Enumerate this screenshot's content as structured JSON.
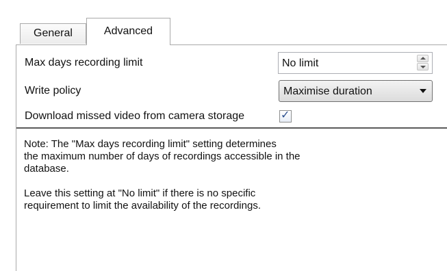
{
  "tabs": [
    {
      "label": "General",
      "active": false
    },
    {
      "label": "Advanced",
      "active": true
    }
  ],
  "settings": {
    "max_days": {
      "label": "Max days recording limit",
      "value": "No limit"
    },
    "write_policy": {
      "label": "Write policy",
      "value": "Maximise duration"
    },
    "download_missed": {
      "label": "Download missed video from camera storage",
      "checked": true
    }
  },
  "note": {
    "line1": "Note: The \"Max days recording limit\" setting determines",
    "line2": "the maximum number of days of recordings accessible in the",
    "line3": "database.",
    "line4": "Leave this setting at \"No limit\" if there is no specific",
    "line5": "requirement to limit the availability of the recordings."
  },
  "icons": {
    "spin_up": "chevron-up-icon",
    "spin_down": "chevron-down-icon",
    "dropdown": "dropdown-arrow-icon",
    "check": "checkmark-icon"
  },
  "colors": {
    "border": "#a9a9a9",
    "separator": "#5a5a5a",
    "check": "#2b4f8f"
  }
}
